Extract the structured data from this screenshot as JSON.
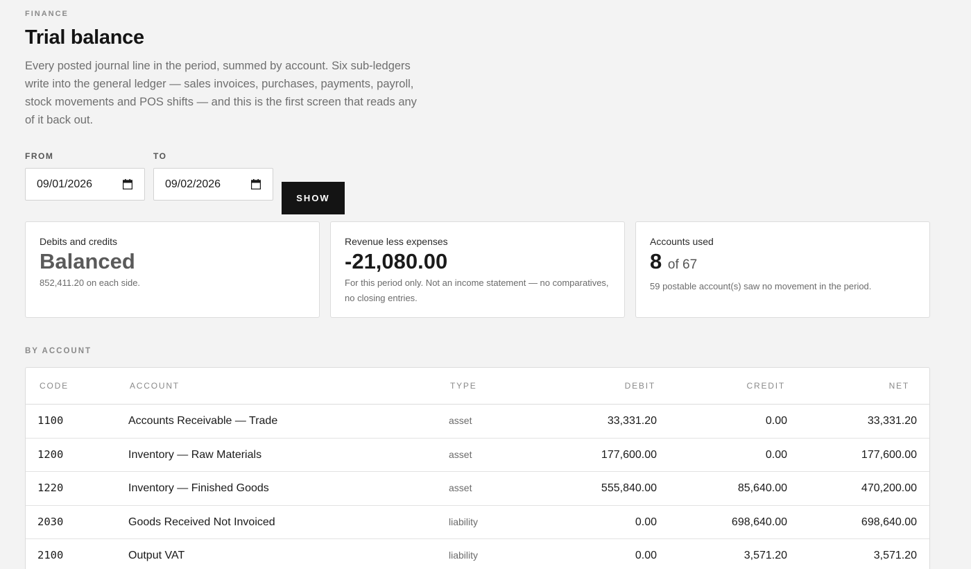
{
  "header": {
    "eyebrow": "FINANCE",
    "title": "Trial balance",
    "intro": "Every posted journal line in the period, summed by account. Six sub-ledgers write into the general ledger — sales invoices, purchases, payments, payroll, stock movements and POS shifts — and this is the first screen that reads any of it back out."
  },
  "filters": {
    "from_label": "FROM",
    "from_value": "09/01/2026",
    "to_label": "TO",
    "to_value": "09/02/2026",
    "show_label": "SHOW"
  },
  "cards": [
    {
      "label": "Debits and credits",
      "value": "Balanced",
      "note": "852,411.20 on each side."
    },
    {
      "label": "Revenue less expenses",
      "value": "-21,080.00",
      "note": "For this period only. Not an income statement — no comparatives, no closing entries."
    },
    {
      "label": "Accounts used",
      "value": "8",
      "value_suffix": "of 67",
      "note": "59 postable account(s) saw no movement in the period."
    }
  ],
  "table": {
    "section_label": "BY ACCOUNT",
    "columns": {
      "code": "CODE",
      "account": "ACCOUNT",
      "type": "TYPE",
      "debit": "DEBIT",
      "credit": "CREDIT",
      "net": "NET"
    },
    "rows": [
      {
        "code": "1100",
        "account": "Accounts Receivable — Trade",
        "type": "asset",
        "debit": "33,331.20",
        "credit": "0.00",
        "net": "33,331.20"
      },
      {
        "code": "1200",
        "account": "Inventory — Raw Materials",
        "type": "asset",
        "debit": "177,600.00",
        "credit": "0.00",
        "net": "177,600.00"
      },
      {
        "code": "1220",
        "account": "Inventory — Finished Goods",
        "type": "asset",
        "debit": "555,840.00",
        "credit": "85,640.00",
        "net": "470,200.00"
      },
      {
        "code": "2030",
        "account": "Goods Received Not Invoiced",
        "type": "liability",
        "debit": "0.00",
        "credit": "698,640.00",
        "net": "698,640.00"
      },
      {
        "code": "2100",
        "account": "Output VAT",
        "type": "liability",
        "debit": "0.00",
        "credit": "3,571.20",
        "net": "3,571.20"
      }
    ]
  }
}
